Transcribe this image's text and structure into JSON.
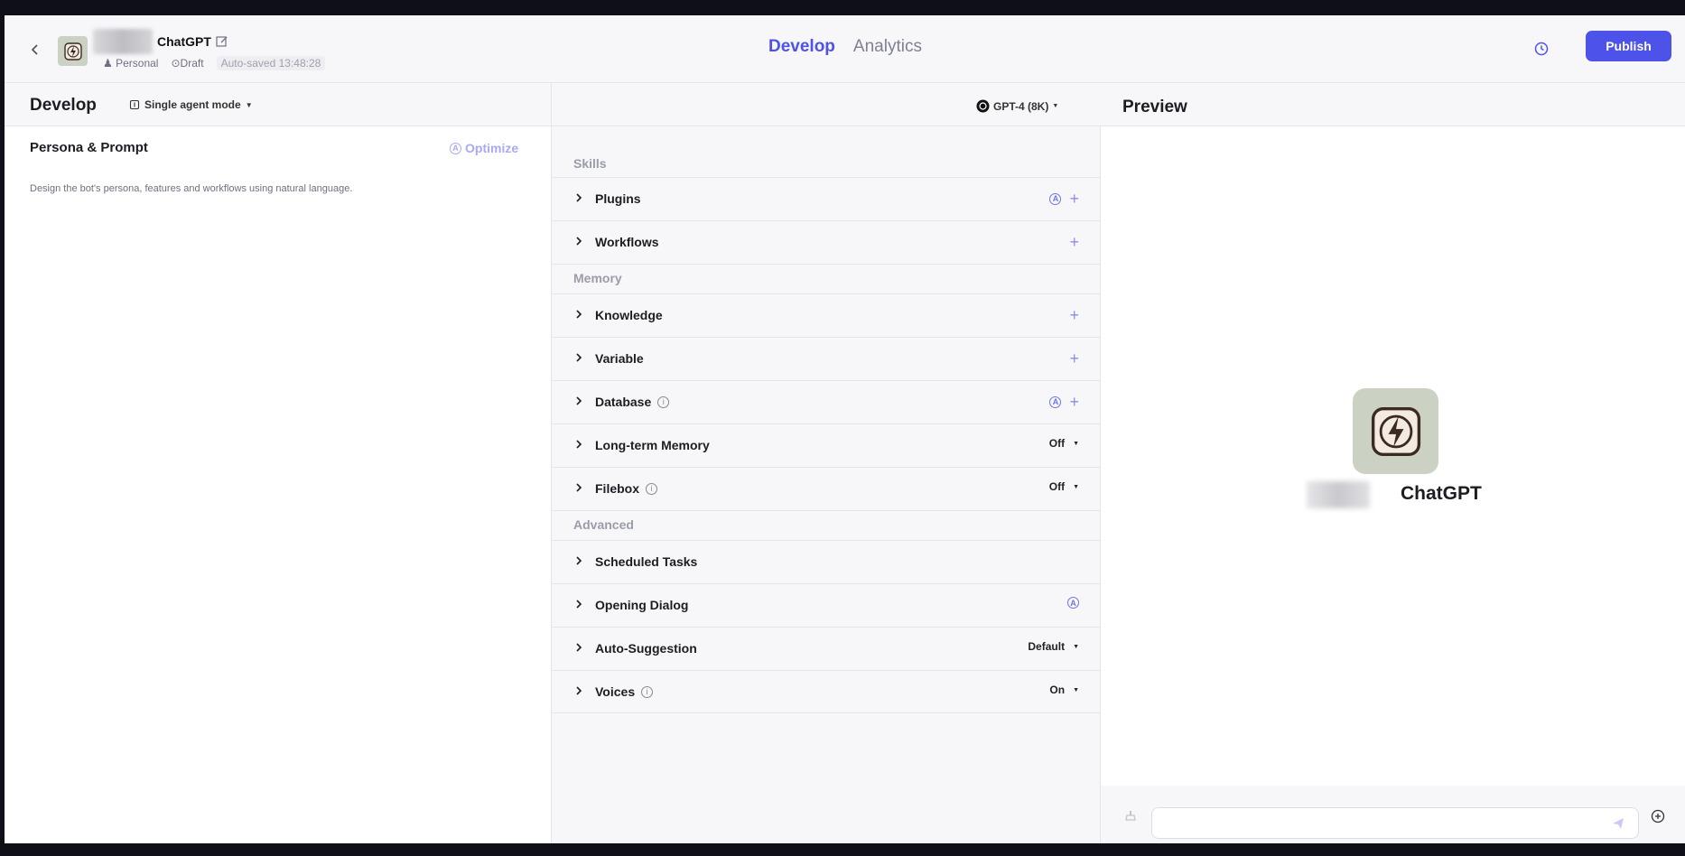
{
  "header": {
    "bot_name": "ChatGPT",
    "space": "Personal",
    "status": "Draft",
    "autosave": "Auto-saved 13:48:28",
    "tabs": [
      {
        "label": "Develop"
      },
      {
        "label": "Analytics"
      }
    ],
    "publish_label": "Publish",
    "accent_color": "#4d53e8"
  },
  "develop": {
    "title": "Develop",
    "mode_label": "Single agent mode",
    "model_label": "GPT-4 (8K)"
  },
  "persona": {
    "title": "Persona & Prompt",
    "optimize_label": "Optimize",
    "description": "Design the bot's persona, features and workflows using natural language."
  },
  "skills": {
    "sections": {
      "skills": "Skills",
      "memory": "Memory",
      "advanced": "Advanced"
    },
    "rows": [
      {
        "label": "Plugins"
      },
      {
        "label": "Workflows"
      },
      {
        "label": "Knowledge"
      },
      {
        "label": "Variable"
      },
      {
        "label": "Database"
      },
      {
        "label": "Long-term Memory",
        "value": "Off"
      },
      {
        "label": "Filebox",
        "value": "Off"
      },
      {
        "label": "Scheduled Tasks"
      },
      {
        "label": "Opening Dialog"
      },
      {
        "label": "Auto-Suggestion",
        "value": "Default"
      },
      {
        "label": "Voices",
        "value": "On"
      }
    ]
  },
  "preview": {
    "title": "Preview",
    "bot_name": "ChatGPT"
  }
}
